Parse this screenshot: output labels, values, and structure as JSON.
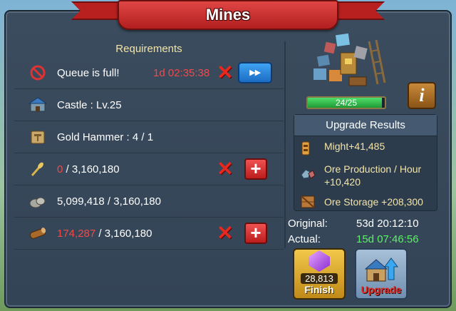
{
  "window": {
    "title": "Mines"
  },
  "requirements": {
    "title": "Requirements",
    "rows": [
      {
        "icon": "no-builder-icon",
        "text": "Queue is full!",
        "timer": "1d 02:35:38",
        "action": "speedup"
      },
      {
        "icon": "castle-icon",
        "text": "Castle : Lv.25"
      },
      {
        "icon": "gold-hammer-icon",
        "text": "Gold Hammer : 4 / 1"
      },
      {
        "icon": "food-icon",
        "current": "0",
        "required": " / 3,160,180",
        "action": "add"
      },
      {
        "icon": "stone-icon",
        "current": "5,099,418",
        "required": " / 3,160,180"
      },
      {
        "icon": "timber-icon",
        "current": "174,287",
        "required": " / 3,160,180",
        "action": "add"
      }
    ]
  },
  "building": {
    "icon": "mine-icon",
    "level_text": "24/25",
    "level_progress": 0.96
  },
  "upgrade_results": {
    "title": "Upgrade Results",
    "might": "Might+41,485",
    "ore_production_label": "Ore Production / Hour",
    "ore_production_value": "+10,420",
    "ore_storage": "Ore Storage +208,300"
  },
  "time": {
    "original_label": "Original:",
    "original_value": "53d 20:12:10",
    "actual_label": "Actual:",
    "actual_value": "15d 07:46:56"
  },
  "buttons": {
    "finish_cost": "28,813",
    "finish_label": "Finish",
    "upgrade_label": "Upgrade",
    "speedup_label": "▸▸",
    "add_label": "+",
    "info_label": "i"
  },
  "colors": {
    "insufficient": "#ef4a4a",
    "actual_time": "#5df06a",
    "results_text": "#f3e5a8"
  }
}
